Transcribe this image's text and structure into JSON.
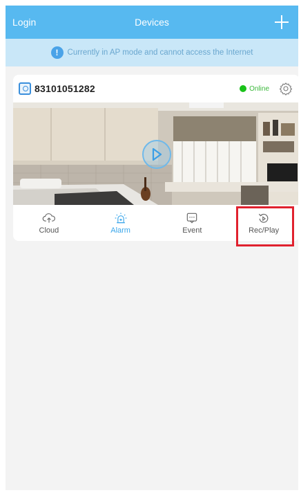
{
  "header": {
    "login_label": "Login",
    "title": "Devices",
    "add_icon": "plus-icon"
  },
  "notice": {
    "icon": "info-icon",
    "icon_glyph": "!",
    "text": "Currently in AP mode and cannot access the Internet"
  },
  "device": {
    "icon": "camera-device-icon",
    "id": "83101051282",
    "status_label": "Online",
    "status_color": "#19c219",
    "settings_icon": "gear-icon",
    "preview_icon": "play-icon"
  },
  "actions": [
    {
      "key": "cloud",
      "label": "Cloud",
      "icon": "cloud-upload-icon",
      "active": false
    },
    {
      "key": "alarm",
      "label": "Alarm",
      "icon": "alarm-siren-icon",
      "active": true
    },
    {
      "key": "event",
      "label": "Event",
      "icon": "event-message-icon",
      "active": false
    },
    {
      "key": "recplay",
      "label": "Rec/Play",
      "icon": "replay-icon",
      "active": false
    }
  ],
  "colors": {
    "header_bg": "#57b9f0",
    "notice_bg": "#c9e7f8",
    "accent": "#3aa6ea",
    "highlight": "#e0212e"
  }
}
